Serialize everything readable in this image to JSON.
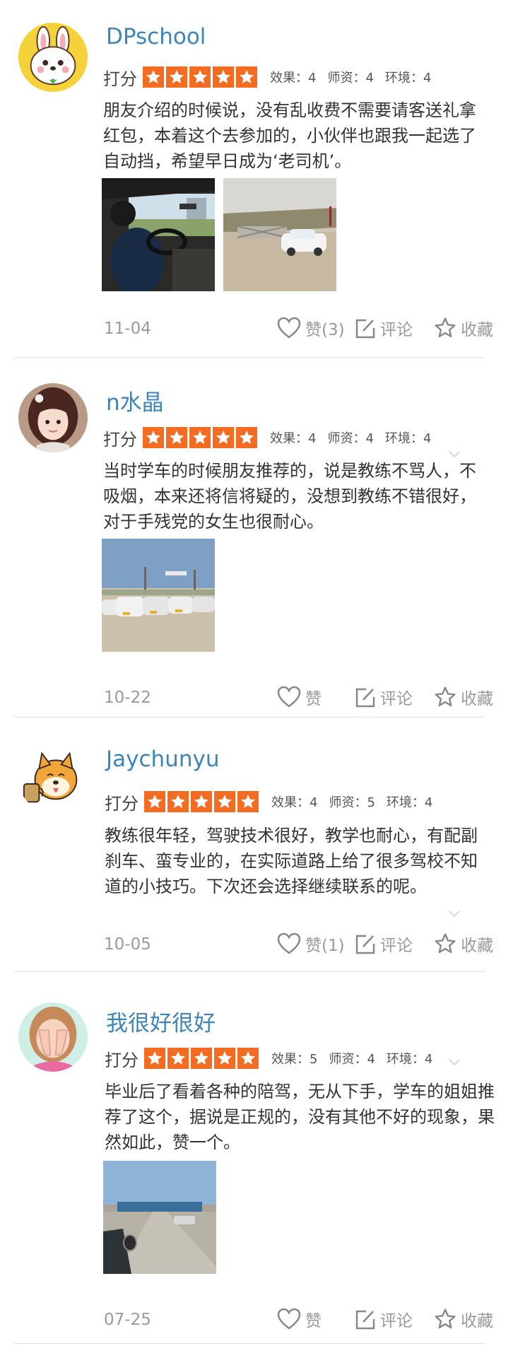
{
  "score_label": "打分",
  "reviews": [
    {
      "username": "DPschool",
      "avatar_icon": "bunny-avatar",
      "scores": {
        "effect": "效果：4",
        "teacher": "师资：4",
        "env": "环境：4"
      },
      "text": "朋友介绍的时候说，没有乱收费不需要请客送礼拿红包，本着这个去参加的，小伙伴也跟我一起选了自动挡，希望早日成为‘老司机’。",
      "photos": [
        "driving-interior-photo",
        "parking-lot-car-photo"
      ],
      "date": "11-04",
      "like_label": "赞(3)",
      "comment_label": "评论",
      "favorite_label": "收藏"
    },
    {
      "username": "n水晶",
      "avatar_icon": "girl-portrait-avatar",
      "scores": {
        "effect": "效果：4",
        "teacher": "师资：4",
        "env": "环境：4"
      },
      "text": "当时学车的时候朋友推荐的，说是教练不骂人，不吸烟，本来还将信将疑的，没想到教练不错很好，对于手残党的女生也很耐心。",
      "photos": [
        "cars-row-photo"
      ],
      "date": "10-22",
      "like_label": "赞",
      "comment_label": "评论",
      "favorite_label": "收藏"
    },
    {
      "username": "Jaychunyu",
      "avatar_icon": "shiba-dog-avatar",
      "scores": {
        "effect": "效果：4",
        "teacher": "师资：5",
        "env": "环境：4"
      },
      "text": "教练很年轻，驾驶技术很好，教学也耐心，有配副刹车、蛮专业的，在实际道路上给了很多驾校不知道的小技巧。下次还会选择继续联系的呢。",
      "photos": [],
      "date": "10-05",
      "like_label": "赞(1)",
      "comment_label": "评论",
      "favorite_label": "收藏"
    },
    {
      "username": "我很好很好",
      "avatar_icon": "hands-over-face-avatar",
      "scores": {
        "effect": "效果：5",
        "teacher": "师资：4",
        "env": "环境：4"
      },
      "text": "毕业后了看着各种的陪驾，无从下手，学车的姐姐推荐了这个，据说是正规的，没有其他不好的现象，果然如此，赞一个。",
      "photos": [
        "training-road-photo"
      ],
      "date": "07-25",
      "like_label": "赞",
      "comment_label": "评论",
      "favorite_label": "收藏"
    }
  ]
}
